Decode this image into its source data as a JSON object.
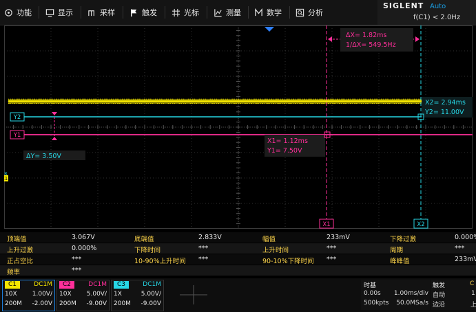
{
  "menu": [
    {
      "label": "功能",
      "icon": "function-icon"
    },
    {
      "label": "显示",
      "icon": "display-icon"
    },
    {
      "label": "采样",
      "icon": "acquire-icon"
    },
    {
      "label": "触发",
      "icon": "trigger-flag-icon"
    },
    {
      "label": "光标",
      "icon": "cursor-icon"
    },
    {
      "label": "测量",
      "icon": "measure-icon"
    },
    {
      "label": "数学",
      "icon": "math-icon"
    },
    {
      "label": "分析",
      "icon": "analysis-icon"
    }
  ],
  "brand": {
    "name": "SIGLENT",
    "mode": "Auto",
    "freq": "f(C1) < 2.0Hz"
  },
  "colors": {
    "c1": "#f5e600",
    "c2": "#ff2f9a",
    "c3": "#27d7e6",
    "accent": "#1c7edb",
    "label": "#ffd64a"
  },
  "cursors": {
    "dx": "ΔX= 1.82ms",
    "inv_dx": "1/ΔX= 549.5Hz",
    "x2_readout": "X2= 2.94ms",
    "y2_readout": "Y2= 11.00V",
    "x1_readout": "X1= 1.12ms",
    "y1_readout": "Y1= 7.50V",
    "dy": "ΔY= 3.50V",
    "y2_tag": "Y2",
    "y1_tag": "Y1",
    "x1_tag": "X1",
    "x2_tag": "X2",
    "c3_marker": "C3",
    "c1_marker": "C1"
  },
  "measurements": [
    [
      {
        "l": "顶端值",
        "v": "3.067V"
      },
      {
        "l": "底端值",
        "v": "2.833V"
      },
      {
        "l": "幅值",
        "v": "233mV"
      },
      {
        "l": "下降过激",
        "v": "0.000%"
      }
    ],
    [
      {
        "l": "上升过激",
        "v": "0.000%"
      },
      {
        "l": "下降时间",
        "v": "***"
      },
      {
        "l": "上升时间",
        "v": "***"
      },
      {
        "l": "周期",
        "v": "***"
      }
    ],
    [
      {
        "l": "正占空比",
        "v": "***"
      },
      {
        "l": "10-90%上升时间",
        "v": "***"
      },
      {
        "l": "90-10%下降时间",
        "v": "***"
      },
      {
        "l": "峰峰值",
        "v": "233mV"
      }
    ],
    [
      {
        "l": "频率",
        "v": "***"
      }
    ]
  ],
  "channels": [
    {
      "tag": "C1",
      "coupling": "DC1M",
      "probe": "10X",
      "scale": "1.00V/",
      "bw": "200M",
      "offset": "-2.00V",
      "color": "#f5e600",
      "active": true
    },
    {
      "tag": "C2",
      "coupling": "DC1M",
      "probe": "10X",
      "scale": "5.00V/",
      "bw": "200M",
      "offset": "-9.00V",
      "color": "#ff2f9a",
      "active": false
    },
    {
      "tag": "C3",
      "coupling": "DC1M",
      "probe": "1X",
      "scale": "5.00V/",
      "bw": "200M",
      "offset": "-9.00V",
      "color": "#27d7e6",
      "active": false
    }
  ],
  "timebase": {
    "title": "时基",
    "delay": "0.00s",
    "tdiv": "1.00ms/div",
    "points": "500kpts",
    "rate": "50.0MSa/s"
  },
  "trigger": {
    "title": "触发",
    "source": "C",
    "mode_label": "自动",
    "mode_val": "1",
    "edge_label": "边沿",
    "edge_val": "上"
  }
}
